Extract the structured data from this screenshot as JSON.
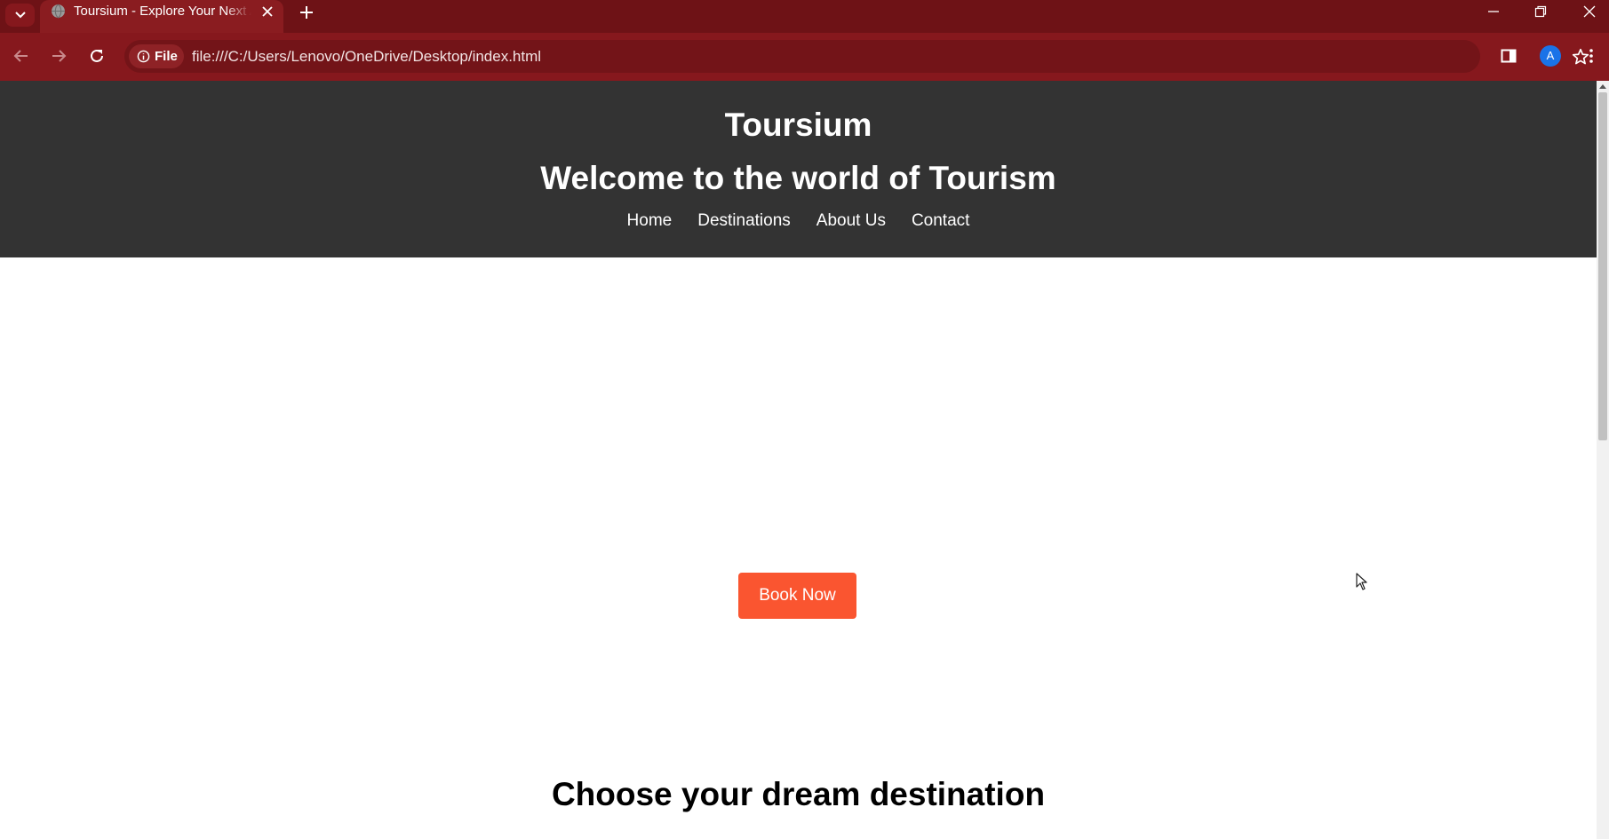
{
  "browser": {
    "tab_title": "Toursium - Explore Your Next Adventure",
    "address_chip": "File",
    "url": "file:///C:/Users/Lenovo/OneDrive/Desktop/index.html",
    "profile_initial": "A",
    "icons": [
      "tab-search-icon",
      "globe-icon",
      "close-icon",
      "plus-icon",
      "minimize-icon",
      "restore-icon",
      "back-icon",
      "forward-icon",
      "reload-icon",
      "info-icon",
      "star-icon",
      "sidebar-icon",
      "menu-icon"
    ]
  },
  "site": {
    "name": "Toursium",
    "tagline": "Welcome to the world of Tourism",
    "nav": [
      "Home",
      "Destinations",
      "About Us",
      "Contact"
    ],
    "cta_label": "Book Now",
    "section_title": "Choose your dream destination"
  },
  "colors": {
    "tabbar": "#6e1216",
    "toolbar": "#86181d",
    "header_bg": "#333333",
    "cta_bg": "#fa5530"
  }
}
